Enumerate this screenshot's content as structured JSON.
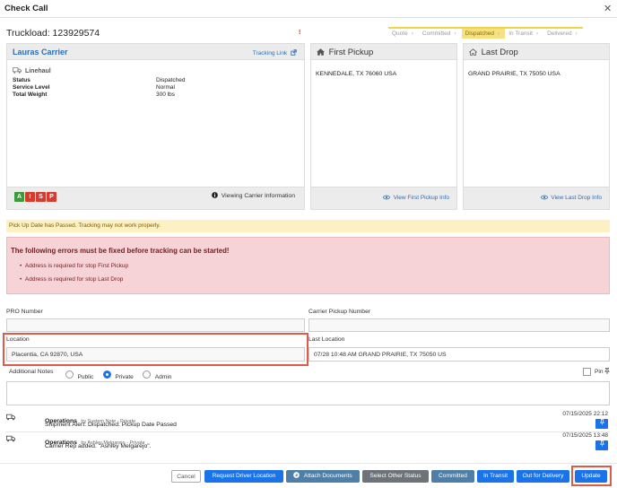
{
  "header": {
    "title": "Check Call",
    "close": "✕"
  },
  "truckload": {
    "label": "Truckload: 123929574",
    "alert": "!"
  },
  "steps": [
    {
      "label": "Quote",
      "active": false
    },
    {
      "label": "Committed",
      "active": false
    },
    {
      "label": "Dispatched",
      "active": true
    },
    {
      "label": "In Transit",
      "active": false
    },
    {
      "label": "Delivered",
      "active": false
    }
  ],
  "carrier": {
    "name": "Lauras Carrier",
    "tracking_link": "Tracking Link",
    "section": "Linehaul",
    "fields": [
      {
        "key": "Status",
        "value": "Dispatched"
      },
      {
        "key": "Service Level",
        "value": "Normal"
      },
      {
        "key": "Total Weight",
        "value": "300 lbs"
      }
    ],
    "badges": [
      {
        "letter": "A",
        "color": "#3a9b3a"
      },
      {
        "letter": "I",
        "color": "#d63b2f"
      },
      {
        "letter": "S",
        "color": "#d63b2f"
      },
      {
        "letter": "P",
        "color": "#d63b2f"
      }
    ],
    "viewing": "Viewing Carrier Information"
  },
  "first_pickup": {
    "title": "First Pickup",
    "address": "KENNEDALE, TX 76060 USA",
    "link": "View First Pickup Info"
  },
  "last_drop": {
    "title": "Last Drop",
    "address": "GRAND PRAIRIE, TX 75050 USA",
    "link": "View Last Drop Info"
  },
  "warning": "Pick Up Date has Passed. Tracking may not work properly.",
  "errors": {
    "title": "The following errors must be fixed before tracking can be started!",
    "items": [
      "Address is required for stop First Pickup",
      "Address is required for stop Last Drop"
    ]
  },
  "form": {
    "pro_label": "PRO Number",
    "pro_value": "",
    "carrier_pickup_label": "Carrier Pickup Number",
    "carrier_pickup_value": "",
    "location_label": "Location",
    "location_value": "Placentia, CA 92870, USA",
    "last_location_label": "Last Location",
    "last_location_value": "07/28 10:48 AM GRAND PRAIRIE, TX 75050 US",
    "notes_label": "Additional Notes",
    "visibility": [
      {
        "label": "Public",
        "selected": false
      },
      {
        "label": "Private",
        "selected": true
      },
      {
        "label": "Admin",
        "selected": false
      }
    ],
    "pin_label": "Pin"
  },
  "notes": [
    {
      "user": "Operations",
      "by": "by System Note - Private",
      "text": "Shipment Alert: Dispatched: Pickup Date Passed",
      "time": "07/15/2025 22:12"
    },
    {
      "user": "Operations",
      "by": "by Ashley Melgarejo - Private",
      "text": "Carrier Rep added. \"Ashley Melgarejo\".",
      "time": "07/15/2025 13:48"
    }
  ],
  "buttons": {
    "cancel": "Cancel",
    "request_driver": "Request Driver Location",
    "attach": "Attach Documents",
    "select_status": "Select Other Status",
    "committed": "Committed",
    "in_transit": "In Transit",
    "out_for_delivery": "Out for Delivery",
    "update": "Update"
  },
  "colors": {
    "accent": "#1a73e8",
    "link": "#2a6fb8",
    "error_bg": "#f5d3d6",
    "warning_bg": "#fdf1c3",
    "highlight": "#e05a4a"
  }
}
